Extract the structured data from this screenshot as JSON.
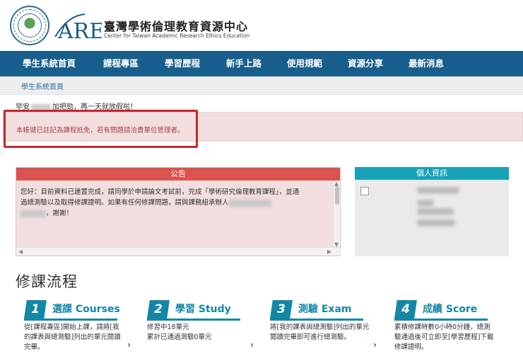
{
  "brand": {
    "title": "臺灣學術倫理教育資源中心",
    "subtitle": "Center for Taiwan Academic Research Ethics Education",
    "seal_text": "MINISTRY OF EDUCATION",
    "seal_label": "教育部",
    "logo_text": "AREE"
  },
  "nav": {
    "items": [
      "學生系統首頁",
      "課程專區",
      "學習歷程",
      "新手上路",
      "使用規範",
      "資源分享",
      "最新消息"
    ]
  },
  "breadcrumb": "學生系統首頁",
  "greeting": {
    "prefix": "早安",
    "suffix": "加把勁，再一天就放假啦！"
  },
  "alert": "本帳號已註記為課程抵免，若有問題請洽貴單位管理者。",
  "announcement": {
    "title": "公告",
    "line1": "您好：目前資料已建置完成，請同學於申請論文考試前，完成「學術研究倫理教育課程」，並通",
    "line2a": "過總測驗以及取得修課證明。如果有任何修課問題，請與課務組承辦人",
    "line3b": "，謝謝！"
  },
  "profile": {
    "title": "個人資訊"
  },
  "flow": {
    "title": "修課流程",
    "steps": [
      {
        "num": "1",
        "label": "選課 Courses",
        "desc": "從[課程專區]開始上課，請將[我的課表與總測驗]列出的單元閱讀完畢。"
      },
      {
        "num": "2",
        "label": "學習 Study",
        "desc": "修習中18單元\n累計已通過測驗0單元"
      },
      {
        "num": "3",
        "label": "測驗 Exam",
        "desc": "將[我的課表與總測驗]列出的單元閱讀完畢即可進行總測驗。"
      },
      {
        "num": "4",
        "label": "成績 Score",
        "desc": "累積修課時數0小時0分鐘，總測驗通過後可立即至[學習歷程]下載修課證明。"
      }
    ]
  },
  "colors": {
    "nav": "#185e8c",
    "accent": "#1486a6",
    "announce_head": "#d9534f",
    "profile_head": "#17a2b8",
    "alert_text": "#a94442",
    "highlight_box": "#c9262c"
  }
}
